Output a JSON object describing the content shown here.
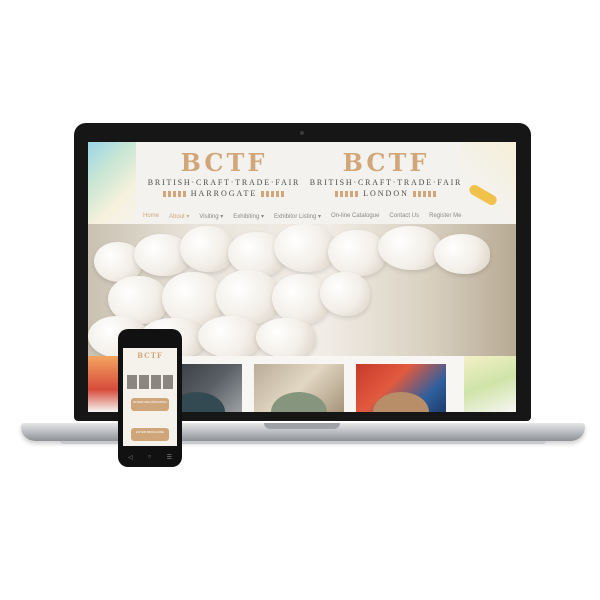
{
  "site": {
    "harrogate": {
      "logo": "BCTF",
      "subtitle": "BRITISH·CRAFT·TRADE·FAIR",
      "city": "HARROGATE"
    },
    "london": {
      "logo": "BCTF",
      "subtitle": "BRITISH·CRAFT·TRADE·FAIR",
      "city": "LONDON"
    }
  },
  "nav": [
    {
      "label": "Home"
    },
    {
      "label": "About ▾"
    },
    {
      "label": "Visiting ▾"
    },
    {
      "label": "Exhibiting ▾"
    },
    {
      "label": "Exhibitor Listing ▾"
    },
    {
      "label": "On-line Catalogue"
    },
    {
      "label": "Contact Us"
    },
    {
      "label": "Register Me"
    }
  ],
  "mobile": {
    "logo": "BCTF",
    "button1": "ENTER REGISTRATION",
    "button2": "ENTER BROCHURE"
  },
  "colors": {
    "accent": "#d1a77a",
    "tile1": "#344a52",
    "tile2": "#86957d",
    "tile3": "#b78e67"
  },
  "icons": [
    "back-icon",
    "home-icon",
    "menu-icon"
  ]
}
